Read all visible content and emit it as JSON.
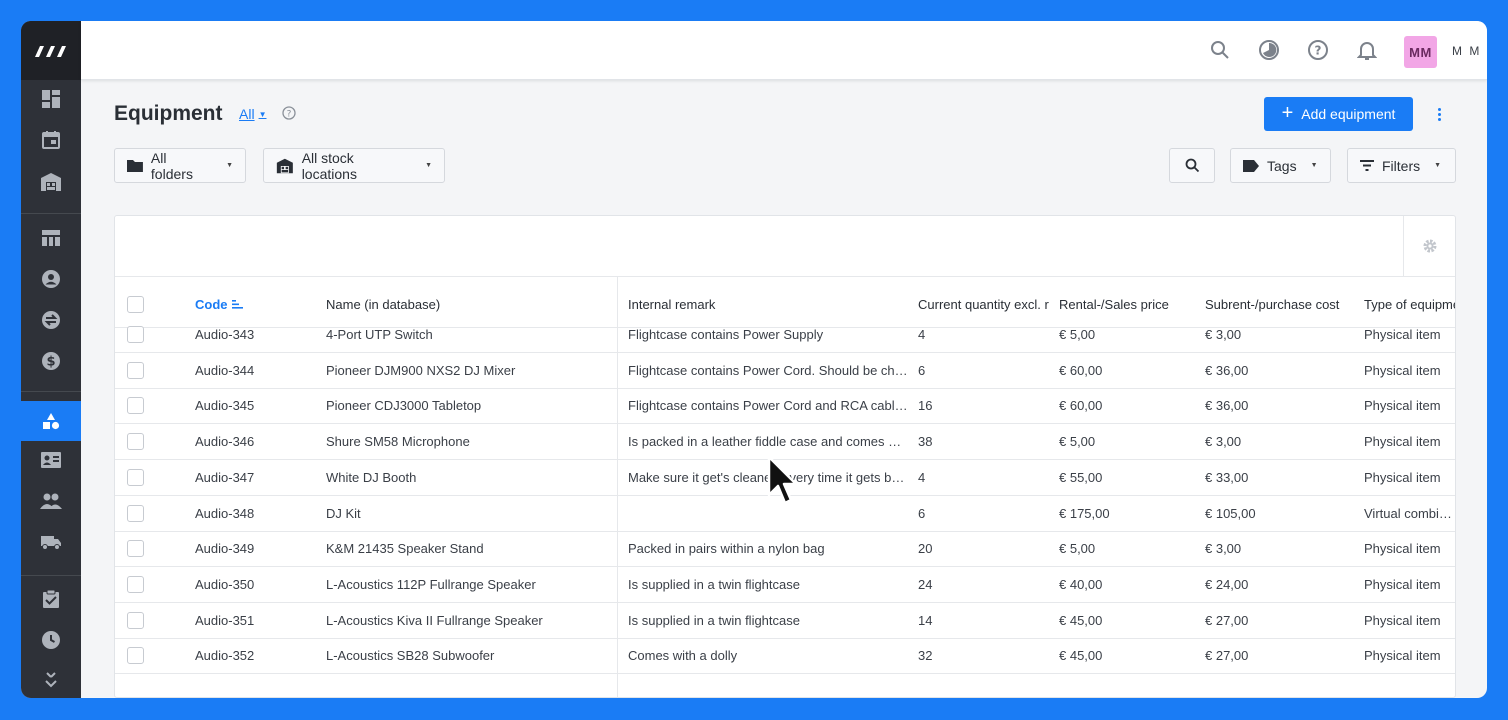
{
  "topbar": {
    "avatar_initials": "MM",
    "user_name": "M M"
  },
  "header": {
    "title": "Equipment",
    "view_filter": "All",
    "add_button": "Add equipment"
  },
  "toolbar": {
    "folders": "All folders",
    "stock_locations": "All stock locations",
    "tags": "Tags",
    "filters": "Filters"
  },
  "table": {
    "columns": [
      "Code",
      "Name (in database)",
      "Internal remark",
      "Current quantity excl. r",
      "Rental-/Sales price",
      "Subrent-/purchase cost",
      "Type of equipme"
    ],
    "rows": [
      [
        "Audio-343",
        "4-Port UTP Switch",
        "Flightcase contains Power Supply",
        "4",
        "€ 5,00",
        "€ 3,00",
        "Physical item"
      ],
      [
        "Audio-344",
        "Pioneer DJM900 NXS2 DJ Mixer",
        "Flightcase contains Power Cord. Should be che…",
        "6",
        "€ 60,00",
        "€ 36,00",
        "Physical item"
      ],
      [
        "Audio-345",
        "Pioneer CDJ3000 Tabletop",
        "Flightcase contains Power Cord and RCA cable. …",
        "16",
        "€ 60,00",
        "€ 36,00",
        "Physical item"
      ],
      [
        "Audio-346",
        "Shure SM58 Microphone",
        "Is packed in a leather fiddle case and comes wit…",
        "38",
        "€ 5,00",
        "€ 3,00",
        "Physical item"
      ],
      [
        "Audio-347",
        "White DJ Booth",
        "Make sure it get's cleaned every time it gets back",
        "4",
        "€ 55,00",
        "€ 33,00",
        "Physical item"
      ],
      [
        "Audio-348",
        "DJ Kit",
        "",
        "6",
        "€ 175,00",
        "€ 105,00",
        "Virtual combinat"
      ],
      [
        "Audio-349",
        "K&M 21435 Speaker Stand",
        "Packed in pairs within a nylon bag",
        "20",
        "€ 5,00",
        "€ 3,00",
        "Physical item"
      ],
      [
        "Audio-350",
        "L-Acoustics 112P Fullrange Speaker",
        "Is supplied in a twin flightcase",
        "24",
        "€ 40,00",
        "€ 24,00",
        "Physical item"
      ],
      [
        "Audio-351",
        "L-Acoustics Kiva II Fullrange Speaker",
        "Is supplied in a twin flightcase",
        "14",
        "€ 45,00",
        "€ 27,00",
        "Physical item"
      ],
      [
        "Audio-352",
        "L-Acoustics SB28 Subwoofer",
        "Comes with a dolly",
        "32",
        "€ 45,00",
        "€ 27,00",
        "Physical item"
      ]
    ]
  },
  "colors": {
    "accent": "#1a7cf5",
    "sidebar": "#2e3138",
    "avatar": "#f2a6e6"
  },
  "sidebar_icons": [
    "dashboard-icon",
    "calendar-icon",
    "warehouse-icon",
    "table-icon",
    "contact-icon",
    "transfer-icon",
    "dollar-icon",
    "equipment-icon",
    "id-card-icon",
    "people-icon",
    "truck-icon",
    "clipboard-check-icon",
    "clock-icon",
    "expand-icon"
  ]
}
